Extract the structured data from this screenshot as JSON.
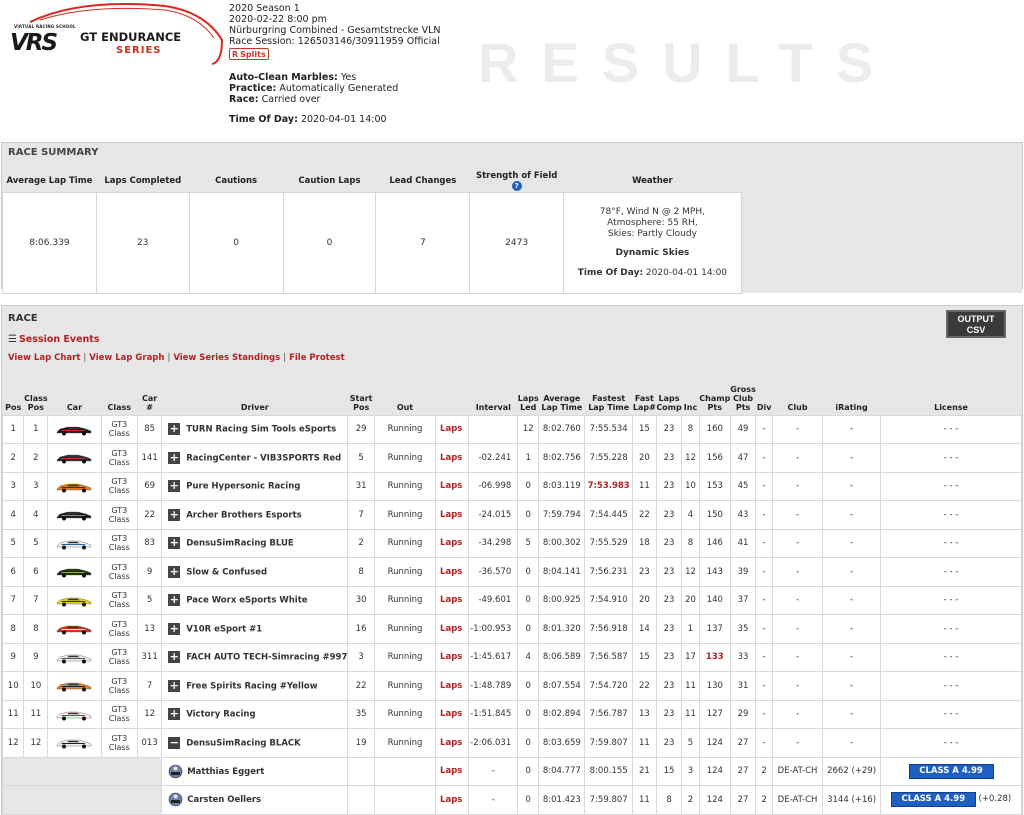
{
  "header": {
    "logo": {
      "school": "VIRTUAL RACING SCHOOL",
      "vrs": "VRS",
      "title1": "GT ENDURANCE",
      "title2": "SERIES"
    },
    "season": "2020 Season 1",
    "datetime": "2020-02-22 8:00 pm",
    "track": "Nürburgring Combined - Gesamtstrecke VLN",
    "race_session": "Race Session: 126503146/30911959 Official",
    "splits_r": "R",
    "splits_label": "Splits",
    "auto_clean_label": "Auto-Clean Marbles:",
    "auto_clean_value": "Yes",
    "practice_label": "Practice:",
    "practice_value": "Automatically Generated",
    "race_label": "Race:",
    "race_value": "Carried over",
    "tod_label": "Time Of Day:",
    "tod_value": "2020-04-01 14:00",
    "big_title": "RESULTS"
  },
  "summary": {
    "title": "RACE SUMMARY",
    "headers": [
      "Average Lap Time",
      "Laps Completed",
      "Cautions",
      "Caution Laps",
      "Lead Changes",
      "Strength of Field",
      "Weather"
    ],
    "values": [
      "8:06.339",
      "23",
      "0",
      "0",
      "7",
      "2473"
    ],
    "weather": {
      "line1": "78°F, Wind N @ 2 MPH,",
      "line2": "Atmosphere: 55 RH,",
      "line3": "Skies: Partly Cloudy",
      "skies": "Dynamic Skies",
      "tod_label": "Time Of Day:",
      "tod_value": "2020-04-01 14:00"
    },
    "help_glyph": "?"
  },
  "race": {
    "title": "RACE",
    "session_events": "Session Events",
    "links": [
      "View Lap Chart",
      "View Lap Graph",
      "View Series Standings",
      "File Protest"
    ],
    "csv_line1": "OUTPUT",
    "csv_line2": "CSV",
    "columns": [
      "Pos",
      "Class Pos",
      "Car",
      "Class",
      "Car #",
      "Driver",
      "Start Pos",
      "Out",
      "",
      "Interval",
      "Laps Led",
      "Average Lap Time",
      "Fastest Lap Time",
      "Fast Lap#",
      "Laps Comp",
      "Inc",
      "Champ Pts",
      "Gross Club Pts",
      "Div",
      "Club",
      "iRating",
      "License"
    ],
    "rows": [
      {
        "pos": "1",
        "cpos": "1",
        "cls1": "GT3",
        "cls2": "Class",
        "num": "85",
        "driver": "TURN Racing Sim Tools eSports",
        "start": "29",
        "out": "Running",
        "laps": "",
        "interval": "",
        "led": "12",
        "avg": "8:02.760",
        "fast": "7:55.534",
        "fastlap": "15",
        "comp": "23",
        "inc": "8",
        "champ": "160",
        "club_pts": "49",
        "div": "-",
        "club": "-",
        "irating": "-",
        "license": "- - -",
        "car_color": "#1a1a1a",
        "car_accent": "#d52b1e"
      },
      {
        "pos": "2",
        "cpos": "2",
        "cls1": "GT3",
        "cls2": "Class",
        "num": "141",
        "driver": "RacingCenter - VIB3SPORTS Red",
        "start": "5",
        "out": "Running",
        "laps": "",
        "interval": "-02.241",
        "led": "1",
        "avg": "8:02.756",
        "fast": "7:55.228",
        "fastlap": "20",
        "comp": "23",
        "inc": "12",
        "champ": "156",
        "club_pts": "47",
        "div": "-",
        "club": "-",
        "irating": "-",
        "license": "- - -",
        "car_color": "#2a2a2a",
        "car_accent": "#c0392b"
      },
      {
        "pos": "3",
        "cpos": "3",
        "cls1": "GT3",
        "cls2": "Class",
        "num": "69",
        "driver": "Pure Hypersonic Racing",
        "start": "31",
        "out": "Running",
        "laps": "",
        "interval": "-06.998",
        "led": "0",
        "avg": "8:03.119",
        "fast": "7:53.983",
        "fastlap": "11",
        "comp": "23",
        "inc": "10",
        "champ": "153",
        "club_pts": "45",
        "div": "-",
        "club": "-",
        "irating": "-",
        "license": "- - -",
        "car_color": "#e8791e",
        "car_accent": "#333333"
      },
      {
        "pos": "4",
        "cpos": "4",
        "cls1": "GT3",
        "cls2": "Class",
        "num": "22",
        "driver": "Archer Brothers Esports",
        "start": "7",
        "out": "Running",
        "laps": "",
        "interval": "-24.015",
        "led": "0",
        "avg": "7:59.794",
        "fast": "7:54.445",
        "fastlap": "22",
        "comp": "23",
        "inc": "4",
        "champ": "150",
        "club_pts": "43",
        "div": "-",
        "club": "-",
        "irating": "-",
        "license": "- - -",
        "car_color": "#1c1c1c",
        "car_accent": "#888888"
      },
      {
        "pos": "5",
        "cpos": "5",
        "cls1": "GT3",
        "cls2": "Class",
        "num": "83",
        "driver": "DensuSimRacing BLUE",
        "start": "2",
        "out": "Running",
        "laps": "",
        "interval": "-34.298",
        "led": "5",
        "avg": "8:00.302",
        "fast": "7:55.529",
        "fastlap": "18",
        "comp": "23",
        "inc": "8",
        "champ": "146",
        "club_pts": "41",
        "div": "-",
        "club": "-",
        "irating": "-",
        "license": "- - -",
        "car_color": "#f2f2f2",
        "car_accent": "#2a5db0"
      },
      {
        "pos": "6",
        "cpos": "6",
        "cls1": "GT3",
        "cls2": "Class",
        "num": "9",
        "driver": "Slow & Confused",
        "start": "8",
        "out": "Running",
        "laps": "",
        "interval": "-36.570",
        "led": "0",
        "avg": "8:04.141",
        "fast": "7:56.231",
        "fastlap": "23",
        "comp": "23",
        "inc": "12",
        "champ": "143",
        "club_pts": "39",
        "div": "-",
        "club": "-",
        "irating": "-",
        "license": "- - -",
        "car_color": "#222222",
        "car_accent": "#6bbf3a"
      },
      {
        "pos": "7",
        "cpos": "7",
        "cls1": "GT3",
        "cls2": "Class",
        "num": "5",
        "driver": "Pace Worx eSports White",
        "start": "30",
        "out": "Running",
        "laps": "",
        "interval": "-49.601",
        "led": "0",
        "avg": "8:00.925",
        "fast": "7:54.910",
        "fastlap": "20",
        "comp": "23",
        "inc": "20",
        "champ": "140",
        "club_pts": "37",
        "div": "-",
        "club": "-",
        "irating": "-",
        "license": "- - -",
        "car_color": "#e6d21a",
        "car_accent": "#333333"
      },
      {
        "pos": "8",
        "cpos": "8",
        "cls1": "GT3",
        "cls2": "Class",
        "num": "13",
        "driver": "V10R eSport #1",
        "start": "16",
        "out": "Running",
        "laps": "",
        "interval": "-1:00.953",
        "led": "0",
        "avg": "8:01.320",
        "fast": "7:56.918",
        "fastlap": "14",
        "comp": "23",
        "inc": "1",
        "champ": "137",
        "club_pts": "35",
        "div": "-",
        "club": "-",
        "irating": "-",
        "license": "- - -",
        "car_color": "#d52b1e",
        "car_accent": "#f2f2f2"
      },
      {
        "pos": "9",
        "cpos": "9",
        "cls1": "GT3",
        "cls2": "Class",
        "num": "311",
        "driver": "FACH AUTO TECH-Simracing #997",
        "start": "3",
        "out": "Running",
        "laps": "",
        "interval": "-1:45.617",
        "led": "4",
        "avg": "8:06.589",
        "fast": "7:56.587",
        "fastlap": "15",
        "comp": "23",
        "inc": "17",
        "champ": "133",
        "club_pts": "33",
        "div": "-",
        "club": "-",
        "irating": "-",
        "license": "- - -",
        "car_color": "#eeeeee",
        "car_accent": "#555555"
      },
      {
        "pos": "10",
        "cpos": "10",
        "cls1": "GT3",
        "cls2": "Class",
        "num": "7",
        "driver": "Free Spirits Racing #Yellow",
        "start": "22",
        "out": "Running",
        "laps": "",
        "interval": "-1:48.789",
        "led": "0",
        "avg": "8:07.554",
        "fast": "7:54.720",
        "fastlap": "22",
        "comp": "23",
        "inc": "11",
        "champ": "130",
        "club_pts": "31",
        "div": "-",
        "club": "-",
        "irating": "-",
        "license": "- - -",
        "car_color": "#e8811e",
        "car_accent": "#222222"
      },
      {
        "pos": "11",
        "cpos": "11",
        "cls1": "GT3",
        "cls2": "Class",
        "num": "12",
        "driver": "Victory Racing",
        "start": "35",
        "out": "Running",
        "laps": "",
        "interval": "-1:51.845",
        "led": "0",
        "avg": "8:02.894",
        "fast": "7:56.787",
        "fastlap": "13",
        "comp": "23",
        "inc": "11",
        "champ": "127",
        "club_pts": "29",
        "div": "-",
        "club": "-",
        "irating": "-",
        "license": "- - -",
        "car_color": "#f2f2f2",
        "car_accent": "#c0392b"
      },
      {
        "pos": "12",
        "cpos": "12",
        "cls1": "GT3",
        "cls2": "Class",
        "num": "013",
        "driver": "DensuSimRacing BLACK",
        "start": "19",
        "out": "Running",
        "laps": "",
        "interval": "-2:06.031",
        "led": "0",
        "avg": "8:03.659",
        "fast": "7:59.807",
        "fastlap": "11",
        "comp": "23",
        "inc": "5",
        "champ": "124",
        "club_pts": "27",
        "div": "-",
        "club": "-",
        "irating": "-",
        "license": "- - -",
        "car_color": "#f0f0f0",
        "car_accent": "#222222"
      }
    ],
    "laps_link": "Laps",
    "sub_rows": [
      {
        "driver": "Matthias Eggert",
        "laps": "Laps",
        "interval": "-",
        "led": "0",
        "avg": "8:04.777",
        "fast": "8:00.155",
        "fastlap": "21",
        "comp": "15",
        "inc": "3",
        "champ": "124",
        "club_pts": "27",
        "div": "2",
        "club": "DE-AT-CH",
        "irating": "2662",
        "irchg": "(+29)",
        "license": "CLASS A 4.99",
        "lic_chg": ""
      },
      {
        "driver": "Carsten Oellers",
        "laps": "Laps",
        "interval": "-",
        "led": "0",
        "avg": "8:01.423",
        "fast": "7:59.807",
        "fastlap": "11",
        "comp": "8",
        "inc": "2",
        "champ": "124",
        "club_pts": "27",
        "div": "2",
        "club": "DE-AT-CH",
        "irating": "3144",
        "irchg": "(+16)",
        "license": "CLASS A 4.99",
        "lic_chg": "(+0.28)"
      }
    ],
    "expand_glyph": "+",
    "collapse_glyph": "−",
    "highlight": {
      "fast_row": 3,
      "champ_row": 9
    }
  }
}
